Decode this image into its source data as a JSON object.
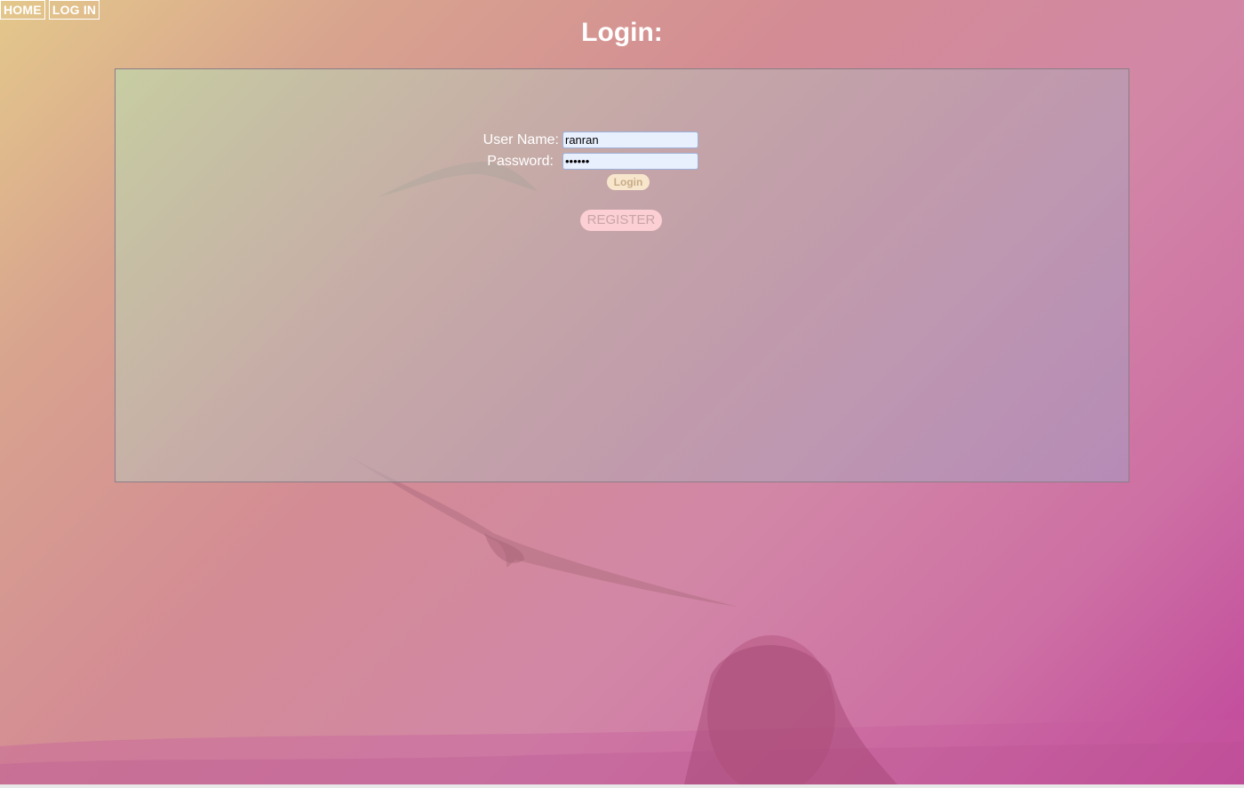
{
  "nav": {
    "home_label": "HOME",
    "login_label": "LOG IN"
  },
  "page": {
    "title": "Login:"
  },
  "form": {
    "username_label": "User Name:",
    "username_value": "ranran",
    "password_label": "Password:",
    "password_value": "••••••",
    "login_label": "Login",
    "register_label": "REGISTER"
  },
  "colors": {
    "gradient_top_left": "#e4c88b",
    "gradient_bottom_right": "#c1479b",
    "input_background": "#e8f0fe",
    "login_button": "#f7e6cc",
    "register_button": "#fbcfd3"
  }
}
